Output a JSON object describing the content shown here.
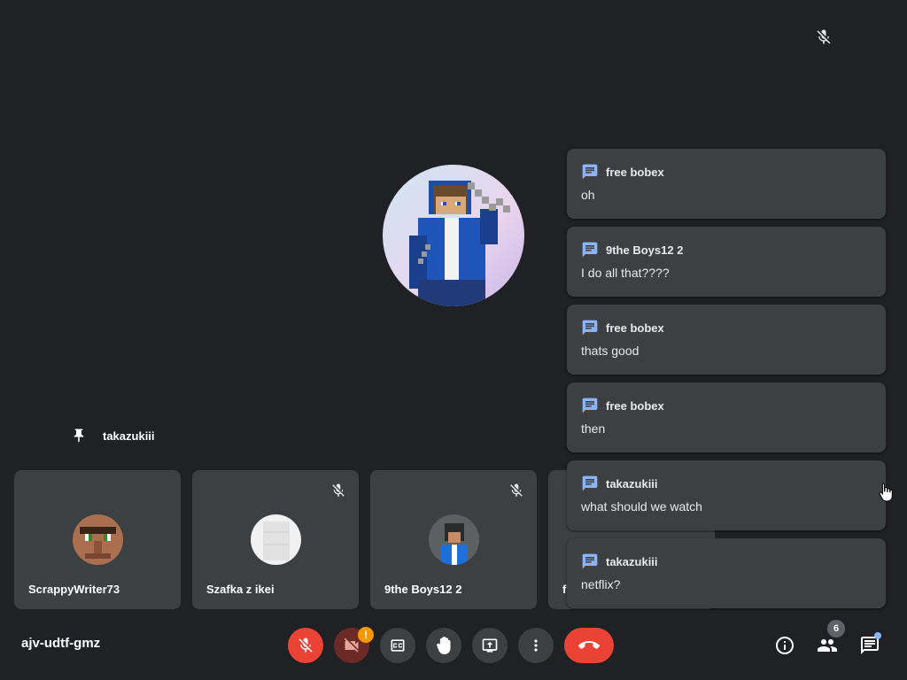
{
  "meeting": {
    "code": "ajv-udtf-gmz",
    "pinned_name": "takazukiii",
    "participant_count": "6"
  },
  "tiles": [
    {
      "name": "ScrappyWriter73",
      "muted": false
    },
    {
      "name": "Szafka z ikei",
      "muted": true
    },
    {
      "name": "9the Boys12 2",
      "muted": true
    },
    {
      "name": "f",
      "muted": false
    }
  ],
  "chat": [
    {
      "sender": "free bobex",
      "text": "oh"
    },
    {
      "sender": "9the Boys12 2",
      "text": "I do all that????"
    },
    {
      "sender": "free bobex",
      "text": "thats good"
    },
    {
      "sender": "free bobex",
      "text": "then"
    },
    {
      "sender": "takazukiii",
      "text": "what should we watch"
    },
    {
      "sender": "takazukiii",
      "text": "netflix?"
    }
  ],
  "controls": {
    "warning_badge": "!"
  },
  "icons": [
    "mic-off-icon",
    "pin-icon",
    "chat-message-icon",
    "camera-off-icon",
    "captions-icon",
    "raise-hand-icon",
    "present-icon",
    "more-vert-icon",
    "end-call-icon",
    "info-icon",
    "people-icon",
    "chat-icon",
    "cursor-icon"
  ],
  "colors": {
    "background": "#202124",
    "tile": "#3c4043",
    "danger": "#ea4335",
    "accent": "#8ab4f8",
    "warning": "#f29900"
  }
}
